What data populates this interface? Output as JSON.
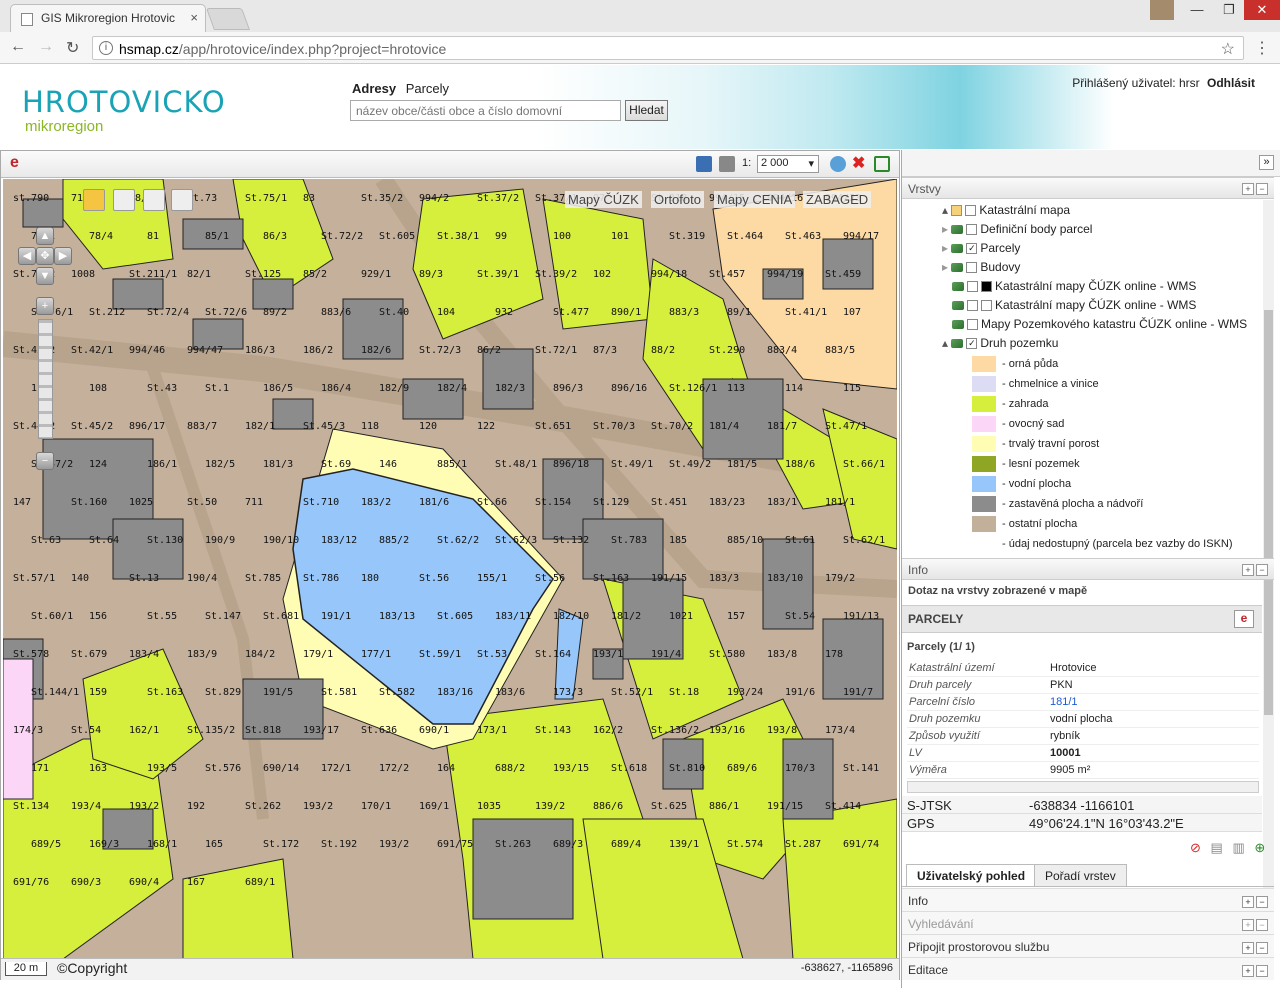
{
  "browser": {
    "tab_title": "GIS Mikroregion Hrotovic",
    "tab_close": "×",
    "url_host": "hsmap.cz",
    "url_path": "/app/hrotovice/index.php?project=hrotovice",
    "url_info": "i",
    "back": "←",
    "forward": "→",
    "reload": "↻",
    "star": "☆",
    "menu": "⋮",
    "win_min": "—",
    "win_max": "❐",
    "win_close": "✕"
  },
  "header": {
    "logo_main": "HROTOVICKO",
    "logo_sub": "mikroregion",
    "search_tab_active": "Adresy",
    "search_tab_other": "Parcely",
    "search_placeholder": "název obce/části obce a číslo domovní",
    "search_button": "Hledat",
    "user_label": "Přihlášený uživatel: hrsr",
    "logout": "Odhlásit"
  },
  "map": {
    "toolbar_logo": "e",
    "scale_prefix": "1:",
    "scale_value": "2 000",
    "base_layers": [
      "Mapy ČÚZK",
      "Ortofoto",
      "Mapy CENIA",
      "ZABAGED"
    ],
    "scale_bar": "20 m",
    "copyright": "©Copyright",
    "cursor_coords": "-638627, -1165896",
    "parcel_labels": [
      {
        "t": "st.790"
      },
      {
        "t": "71/1"
      },
      {
        "t": "88/2"
      },
      {
        "t": "St.73"
      },
      {
        "t": "St.75/1"
      },
      {
        "t": "83"
      },
      {
        "t": "St.35/2"
      },
      {
        "t": "994/2"
      },
      {
        "t": "St.37/2"
      },
      {
        "t": "St.37/1"
      },
      {
        "t": "97"
      },
      {
        "t": "St.318"
      },
      {
        "t": "994/15"
      },
      {
        "t": "994/16"
      },
      {
        "t": "994/23"
      },
      {
        "t": "73/1"
      },
      {
        "t": "78/4"
      },
      {
        "t": "81"
      },
      {
        "t": "85/1"
      },
      {
        "t": "86/3"
      },
      {
        "t": "St.72/2"
      },
      {
        "t": "St.605"
      },
      {
        "t": "St.38/1"
      },
      {
        "t": "99"
      },
      {
        "t": "100"
      },
      {
        "t": "101"
      },
      {
        "t": "St.319"
      },
      {
        "t": "St.464"
      },
      {
        "t": "St.463"
      },
      {
        "t": "994/17"
      },
      {
        "t": "St.76/2"
      },
      {
        "t": "1008"
      },
      {
        "t": "St.211/1"
      },
      {
        "t": "82/1"
      },
      {
        "t": "St.125"
      },
      {
        "t": "85/2"
      },
      {
        "t": "929/1"
      },
      {
        "t": "89/3"
      },
      {
        "t": "St.39/1"
      },
      {
        "t": "St.39/2"
      },
      {
        "t": "102"
      },
      {
        "t": "994/18"
      },
      {
        "t": "St.457"
      },
      {
        "t": "994/19"
      },
      {
        "t": "St.459"
      },
      {
        "t": "St.76/1"
      },
      {
        "t": "St.212"
      },
      {
        "t": "St.72/4"
      },
      {
        "t": "St.72/6"
      },
      {
        "t": "89/2"
      },
      {
        "t": "883/6"
      },
      {
        "t": "St.40"
      },
      {
        "t": "104"
      },
      {
        "t": "932"
      },
      {
        "t": "St.477"
      },
      {
        "t": "890/1"
      },
      {
        "t": "883/3"
      },
      {
        "t": "89/1"
      },
      {
        "t": "St.41/1"
      },
      {
        "t": "107"
      },
      {
        "t": "St.42/2"
      },
      {
        "t": "St.42/1"
      },
      {
        "t": "994/46"
      },
      {
        "t": "994/47"
      },
      {
        "t": "186/3"
      },
      {
        "t": "186/2"
      },
      {
        "t": "182/6"
      },
      {
        "t": "St.72/3"
      },
      {
        "t": "86/2"
      },
      {
        "t": "St.72/1"
      },
      {
        "t": "87/3"
      },
      {
        "t": "88/2"
      },
      {
        "t": "St.290"
      },
      {
        "t": "883/4"
      },
      {
        "t": "883/5"
      },
      {
        "t": "112"
      },
      {
        "t": "108"
      },
      {
        "t": "St.43"
      },
      {
        "t": "St.1"
      },
      {
        "t": "186/5"
      },
      {
        "t": "186/4"
      },
      {
        "t": "182/9"
      },
      {
        "t": "182/4"
      },
      {
        "t": "182/3"
      },
      {
        "t": "896/3"
      },
      {
        "t": "896/16"
      },
      {
        "t": "St.126/1"
      },
      {
        "t": "113"
      },
      {
        "t": "114"
      },
      {
        "t": "115"
      },
      {
        "t": "St.44/2"
      },
      {
        "t": "St.45/2"
      },
      {
        "t": "896/17"
      },
      {
        "t": "883/7"
      },
      {
        "t": "182/1"
      },
      {
        "t": "St.45/3"
      },
      {
        "t": "118"
      },
      {
        "t": "120"
      },
      {
        "t": "122"
      },
      {
        "t": "St.651"
      },
      {
        "t": "St.70/3"
      },
      {
        "t": "St.70/2"
      },
      {
        "t": "181/4"
      },
      {
        "t": "181/7"
      },
      {
        "t": "St.47/1"
      },
      {
        "t": "St.47/2"
      },
      {
        "t": "124"
      },
      {
        "t": "186/1"
      },
      {
        "t": "182/5"
      },
      {
        "t": "181/3"
      },
      {
        "t": "St.69"
      },
      {
        "t": "146"
      },
      {
        "t": "885/1"
      },
      {
        "t": "St.48/1"
      },
      {
        "t": "896/18"
      },
      {
        "t": "St.49/1"
      },
      {
        "t": "St.49/2"
      },
      {
        "t": "181/5"
      },
      {
        "t": "188/6"
      },
      {
        "t": "St.66/1"
      },
      {
        "t": "147"
      },
      {
        "t": "St.160"
      },
      {
        "t": "1025"
      },
      {
        "t": "St.50"
      },
      {
        "t": "711"
      },
      {
        "t": "St.710"
      },
      {
        "t": "183/2"
      },
      {
        "t": "181/6"
      },
      {
        "t": "St.66"
      },
      {
        "t": "St.154"
      },
      {
        "t": "St.129"
      },
      {
        "t": "St.451"
      },
      {
        "t": "183/23"
      },
      {
        "t": "183/1"
      },
      {
        "t": "181/1"
      },
      {
        "t": "St.63"
      },
      {
        "t": "St.64"
      },
      {
        "t": "St.130"
      },
      {
        "t": "190/9"
      },
      {
        "t": "190/10"
      },
      {
        "t": "183/12"
      },
      {
        "t": "885/2"
      },
      {
        "t": "St.62/2"
      },
      {
        "t": "St.62/3"
      },
      {
        "t": "St.132"
      },
      {
        "t": "St.783"
      },
      {
        "t": "185"
      },
      {
        "t": "885/10"
      },
      {
        "t": "St.61"
      },
      {
        "t": "St.62/1"
      },
      {
        "t": "St.57/1"
      },
      {
        "t": "140"
      },
      {
        "t": "St.13"
      },
      {
        "t": "190/4"
      },
      {
        "t": "St.785"
      },
      {
        "t": "St.786"
      },
      {
        "t": "180"
      },
      {
        "t": "St.56"
      },
      {
        "t": "155/1"
      },
      {
        "t": "St.56"
      },
      {
        "t": "St.163"
      },
      {
        "t": "191/15"
      },
      {
        "t": "183/3"
      },
      {
        "t": "183/10"
      },
      {
        "t": "179/2"
      },
      {
        "t": "St.60/1"
      },
      {
        "t": "156"
      },
      {
        "t": "St.55"
      },
      {
        "t": "St.147"
      },
      {
        "t": "St.681"
      },
      {
        "t": "191/1"
      },
      {
        "t": "183/13"
      },
      {
        "t": "St.605"
      },
      {
        "t": "183/11"
      },
      {
        "t": "182/10"
      },
      {
        "t": "181/2"
      },
      {
        "t": "1021"
      },
      {
        "t": "157"
      },
      {
        "t": "St.54"
      },
      {
        "t": "191/13"
      },
      {
        "t": "St.578"
      },
      {
        "t": "St.679"
      },
      {
        "t": "183/4"
      },
      {
        "t": "183/9"
      },
      {
        "t": "184/2"
      },
      {
        "t": "179/1"
      },
      {
        "t": "177/1"
      },
      {
        "t": "St.59/1"
      },
      {
        "t": "St.53"
      },
      {
        "t": "St.164"
      },
      {
        "t": "193/1"
      },
      {
        "t": "191/4"
      },
      {
        "t": "St.580"
      },
      {
        "t": "183/8"
      },
      {
        "t": "178"
      },
      {
        "t": "St.144/1"
      },
      {
        "t": "159"
      },
      {
        "t": "St.163"
      },
      {
        "t": "St.829"
      },
      {
        "t": "191/5"
      },
      {
        "t": "St.581"
      },
      {
        "t": "St.582"
      },
      {
        "t": "183/16"
      },
      {
        "t": "183/6"
      },
      {
        "t": "173/3"
      },
      {
        "t": "St.52/1"
      },
      {
        "t": "St.18"
      },
      {
        "t": "193/24"
      },
      {
        "t": "191/6"
      },
      {
        "t": "191/7"
      },
      {
        "t": "174/3"
      },
      {
        "t": "St.54"
      },
      {
        "t": "162/1"
      },
      {
        "t": "St.135/2"
      },
      {
        "t": "St.818"
      },
      {
        "t": "193/17"
      },
      {
        "t": "St.636"
      },
      {
        "t": "690/1"
      },
      {
        "t": "173/1"
      },
      {
        "t": "St.143"
      },
      {
        "t": "162/2"
      },
      {
        "t": "St.136/2"
      },
      {
        "t": "193/16"
      },
      {
        "t": "193/8"
      },
      {
        "t": "173/4"
      },
      {
        "t": "171"
      },
      {
        "t": "163"
      },
      {
        "t": "193/5"
      },
      {
        "t": "St.576"
      },
      {
        "t": "690/14"
      },
      {
        "t": "172/1"
      },
      {
        "t": "172/2"
      },
      {
        "t": "164"
      },
      {
        "t": "688/2"
      },
      {
        "t": "193/15"
      },
      {
        "t": "St.618"
      },
      {
        "t": "St.810"
      },
      {
        "t": "689/6"
      },
      {
        "t": "170/3"
      },
      {
        "t": "St.141"
      },
      {
        "t": "St.134"
      },
      {
        "t": "193/4"
      },
      {
        "t": "193/2"
      },
      {
        "t": "192"
      },
      {
        "t": "St.262"
      },
      {
        "t": "193/2"
      },
      {
        "t": "170/1"
      },
      {
        "t": "169/1"
      },
      {
        "t": "1035"
      },
      {
        "t": "139/2"
      },
      {
        "t": "886/6"
      },
      {
        "t": "St.625"
      },
      {
        "t": "886/1"
      },
      {
        "t": "191/15"
      },
      {
        "t": "St.414"
      },
      {
        "t": "689/5"
      },
      {
        "t": "169/3"
      },
      {
        "t": "168/1"
      },
      {
        "t": "165"
      },
      {
        "t": "St.172"
      },
      {
        "t": "St.192"
      },
      {
        "t": "193/2"
      },
      {
        "t": "691/75"
      },
      {
        "t": "St.263"
      },
      {
        "t": "689/3"
      },
      {
        "t": "689/4"
      },
      {
        "t": "139/1"
      },
      {
        "t": "St.574"
      },
      {
        "t": "St.287"
      },
      {
        "t": "691/74"
      },
      {
        "t": "691/76"
      },
      {
        "t": "690/3"
      },
      {
        "t": "690/4"
      },
      {
        "t": "167"
      },
      {
        "t": "689/1"
      }
    ]
  },
  "panel": {
    "collapse_arrow": "»",
    "layers_title": "Vrstvy",
    "layers": [
      {
        "name": "Katastrální mapa",
        "checked": false
      },
      {
        "name": "Definiční body parcel",
        "checked": false
      },
      {
        "name": "Parcely",
        "checked": true
      },
      {
        "name": "Budovy",
        "checked": false
      },
      {
        "name": "Katastrální mapy ČÚZK online - WMS",
        "checked": false
      },
      {
        "name": "Katastrální mapy ČÚZK online - WMS",
        "checked": false
      },
      {
        "name": "Mapy Pozemkového katastru ČÚZK online - WMS",
        "checked": false
      },
      {
        "name": "Druh pozemku",
        "checked": true
      }
    ],
    "legend": [
      {
        "label": "- orná půda",
        "color": "#fdd9a4"
      },
      {
        "label": "- chmelnice a vinice",
        "color": "#dcdcf4"
      },
      {
        "label": "- zahrada",
        "color": "#d6ee3c"
      },
      {
        "label": "- ovocný sad",
        "color": "#fcd6f6"
      },
      {
        "label": "- trvalý travní porost",
        "color": "#fffcb4"
      },
      {
        "label": "- lesní pozemek",
        "color": "#8fa624"
      },
      {
        "label": "- vodní plocha",
        "color": "#96c6fa"
      },
      {
        "label": "- zastavěná plocha a nádvoří",
        "color": "#8c8c8c"
      },
      {
        "label": "- ostatní plocha",
        "color": "#c2b09a"
      },
      {
        "label": "- údaj nedostupný (parcela bez vazby do ISKN)",
        "color": "#ffffff"
      }
    ],
    "info_title": "Info",
    "query_title": "Dotaz na vrstvy zobrazené v mapě",
    "result_layer": "PARCELY",
    "result_count": "Parcely (1/ 1)",
    "attributes": [
      {
        "k": "Katastrální území",
        "v": "Hrotovice"
      },
      {
        "k": "Druh parcely",
        "v": "PKN"
      },
      {
        "k": "Parcelní číslo",
        "v": "181/1"
      },
      {
        "k": "Druh pozemku",
        "v": "vodní plocha"
      },
      {
        "k": "Způsob využití",
        "v": "rybník"
      },
      {
        "k": "LV",
        "v": "10001"
      },
      {
        "k": "Výměra",
        "v": "9905 m²"
      }
    ],
    "sjtsk_label": "S-JTSK",
    "sjtsk_value": "-638834 -1166101",
    "gps_label": "GPS",
    "gps_value": "49°06'24.1\"N 16°03'43.2\"E",
    "tab_user_view": "Uživatelský pohled",
    "tab_layer_order": "Pořadí vrstev",
    "bottom_sections": [
      "Info",
      "Vyhledávání",
      "Připojit prostorovou službu",
      "Editace"
    ],
    "colors": {
      "accent": "#1aa3b5",
      "brand_green": "#8ab724",
      "link": "#1e5bd6"
    }
  }
}
